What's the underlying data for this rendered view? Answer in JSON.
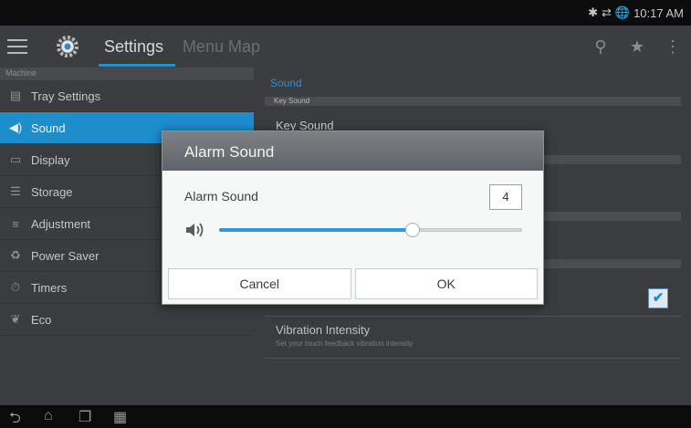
{
  "status_bar": {
    "time": "10:17 AM"
  },
  "action_bar": {
    "title": "Settings",
    "secondary_title": "Menu Map",
    "accent_color": "#2d8cc8"
  },
  "sidebar": {
    "header": "Machine",
    "items": [
      {
        "label": "Tray Settings",
        "icon": "tray-icon",
        "active": false
      },
      {
        "label": "Sound",
        "icon": "speaker-icon",
        "active": true
      },
      {
        "label": "Display",
        "icon": "monitor-icon",
        "active": false
      },
      {
        "label": "Storage",
        "icon": "database-icon",
        "active": false
      },
      {
        "label": "Adjustment",
        "icon": "sliders-icon",
        "active": false
      },
      {
        "label": "Power Saver",
        "icon": "recycle-icon",
        "active": false
      },
      {
        "label": "Timers",
        "icon": "timer-icon",
        "active": false
      },
      {
        "label": "Eco",
        "icon": "leaf-icon",
        "active": false
      }
    ]
  },
  "content": {
    "section_title": "Sound",
    "subheader_key": "Key Sound",
    "key_sound_label": "Key Sound",
    "vibration_title": "Vibration Intensity",
    "vibration_desc": "Set your touch feedback vibration intensity",
    "checkbox_checked": true
  },
  "dialog": {
    "title": "Alarm Sound",
    "label": "Alarm Sound",
    "value": "4",
    "slider_fraction": 0.64,
    "cancel_label": "Cancel",
    "ok_label": "OK"
  }
}
